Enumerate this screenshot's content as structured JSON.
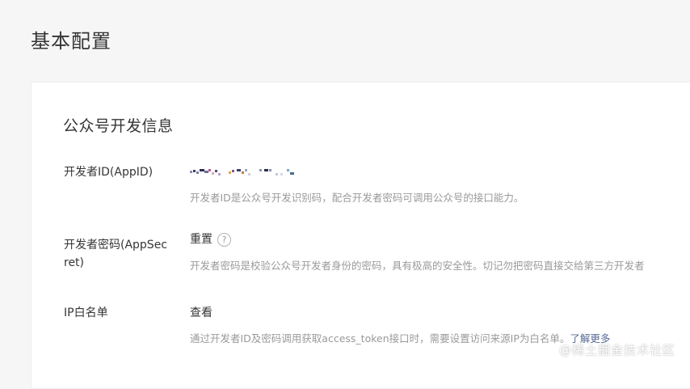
{
  "page": {
    "title": "基本配置"
  },
  "section": {
    "title": "公众号开发信息"
  },
  "rows": {
    "appid": {
      "label": "开发者ID(AppID)",
      "value": "wx••••••••••••••",
      "desc": "开发者ID是公众号开发识别码，配合开发者密码可调用公众号的接口能力。"
    },
    "appsecret": {
      "label": "开发者密码(AppSecret)",
      "action": "重置",
      "help_icon": "question-circle-icon",
      "desc": "开发者密码是校验公众号开发者身份的密码，具有极高的安全性。切记勿把密码直接交给第三方开发者"
    },
    "ip_whitelist": {
      "label": "IP白名单",
      "action": "查看",
      "desc": "通过开发者ID及密码调用获取access_token接口时，需要设置访问来源IP为白名单。",
      "learn_more": "了解更多"
    }
  },
  "watermark": "@稀土掘金技术社区",
  "colors": {
    "background": "#f6f6f6",
    "text": "#353535",
    "muted": "#9a9a9a",
    "link": "#576b95"
  }
}
